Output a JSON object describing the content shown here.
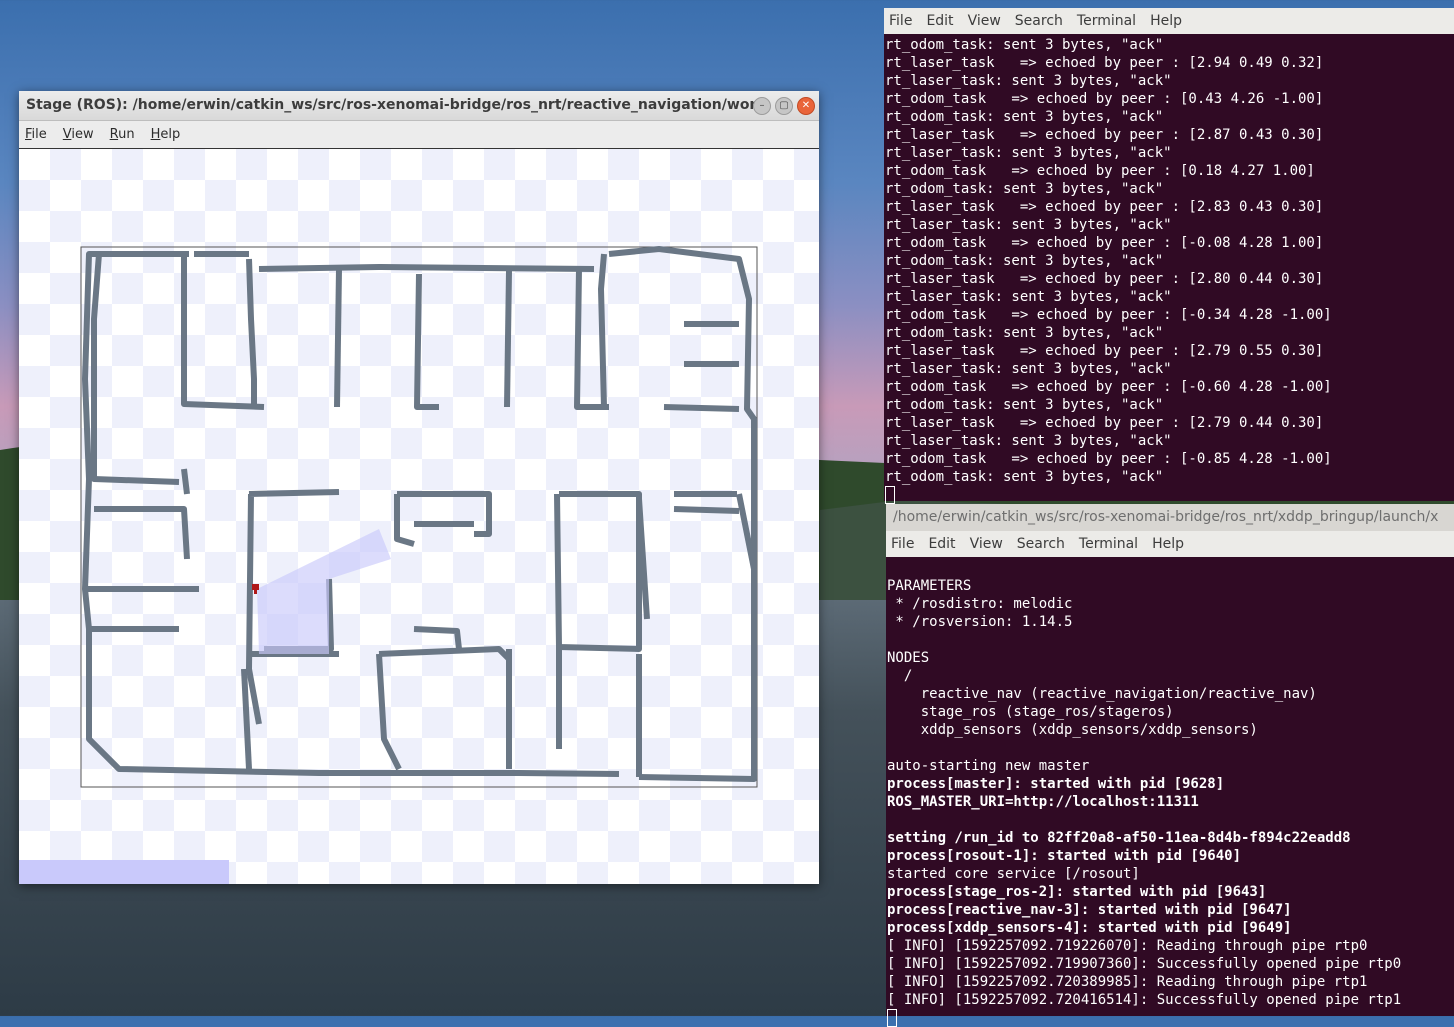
{
  "stage_window": {
    "title": "Stage (ROS): /home/erwin/catkin_ws/src/ros-xenomai-bridge/ros_nrt/reactive_navigation/worlds/ro...",
    "menu": [
      "File",
      "View",
      "Run",
      "Help"
    ],
    "buttons": {
      "minimize": "–",
      "maximize": "▢",
      "close": "✕"
    }
  },
  "terminal1": {
    "menu": [
      "File",
      "Edit",
      "View",
      "Search",
      "Terminal",
      "Help"
    ],
    "lines": [
      "rt_odom_task: sent 3 bytes, \"ack\"",
      "rt_laser_task   => echoed by peer : [2.94 0.49 0.32]",
      "rt_laser_task: sent 3 bytes, \"ack\"",
      "rt_odom_task   => echoed by peer : [0.43 4.26 -1.00]",
      "rt_odom_task: sent 3 bytes, \"ack\"",
      "rt_laser_task   => echoed by peer : [2.87 0.43 0.30]",
      "rt_laser_task: sent 3 bytes, \"ack\"",
      "rt_odom_task   => echoed by peer : [0.18 4.27 1.00]",
      "rt_odom_task: sent 3 bytes, \"ack\"",
      "rt_laser_task   => echoed by peer : [2.83 0.43 0.30]",
      "rt_laser_task: sent 3 bytes, \"ack\"",
      "rt_odom_task   => echoed by peer : [-0.08 4.28 1.00]",
      "rt_odom_task: sent 3 bytes, \"ack\"",
      "rt_laser_task   => echoed by peer : [2.80 0.44 0.30]",
      "rt_laser_task: sent 3 bytes, \"ack\"",
      "rt_odom_task   => echoed by peer : [-0.34 4.28 -1.00]",
      "rt_odom_task: sent 3 bytes, \"ack\"",
      "rt_laser_task   => echoed by peer : [2.79 0.55 0.30]",
      "rt_laser_task: sent 3 bytes, \"ack\"",
      "rt_odom_task   => echoed by peer : [-0.60 4.28 -1.00]",
      "rt_odom_task: sent 3 bytes, \"ack\"",
      "rt_laser_task   => echoed by peer : [2.79 0.44 0.30]",
      "rt_laser_task: sent 3 bytes, \"ack\"",
      "rt_odom_task   => echoed by peer : [-0.85 4.28 -1.00]",
      "rt_odom_task: sent 3 bytes, \"ack\""
    ]
  },
  "terminal2": {
    "title": "/home/erwin/catkin_ws/src/ros-xenomai-bridge/ros_nrt/xddp_bringup/launch/x",
    "menu": [
      "File",
      "Edit",
      "View",
      "Search",
      "Terminal",
      "Help"
    ],
    "lines": [
      {
        "text": "",
        "bold": false
      },
      {
        "text": "PARAMETERS",
        "bold": false
      },
      {
        "text": " * /rosdistro: melodic",
        "bold": false
      },
      {
        "text": " * /rosversion: 1.14.5",
        "bold": false
      },
      {
        "text": "",
        "bold": false
      },
      {
        "text": "NODES",
        "bold": false
      },
      {
        "text": "  /",
        "bold": false
      },
      {
        "text": "    reactive_nav (reactive_navigation/reactive_nav)",
        "bold": false
      },
      {
        "text": "    stage_ros (stage_ros/stageros)",
        "bold": false
      },
      {
        "text": "    xddp_sensors (xddp_sensors/xddp_sensors)",
        "bold": false
      },
      {
        "text": "",
        "bold": false
      },
      {
        "text": "auto-starting new master",
        "bold": false
      },
      {
        "text": "process[master]: started with pid [9628]",
        "bold": true
      },
      {
        "text": "ROS_MASTER_URI=http://localhost:11311",
        "bold": true
      },
      {
        "text": "",
        "bold": false
      },
      {
        "text": "setting /run_id to 82ff20a8-af50-11ea-8d4b-f894c22eadd8",
        "bold": true
      },
      {
        "text": "process[rosout-1]: started with pid [9640]",
        "bold": true
      },
      {
        "text": "started core service [/rosout]",
        "bold": false
      },
      {
        "text": "process[stage_ros-2]: started with pid [9643]",
        "bold": true
      },
      {
        "text": "process[reactive_nav-3]: started with pid [9647]",
        "bold": true
      },
      {
        "text": "process[xddp_sensors-4]: started with pid [9649]",
        "bold": true
      },
      {
        "text": "[ INFO] [1592257092.719226070]: Reading through pipe rtp0",
        "bold": false
      },
      {
        "text": "[ INFO] [1592257092.719907360]: Successfully opened pipe rtp0",
        "bold": false
      },
      {
        "text": "[ INFO] [1592257092.720389985]: Reading through pipe rtp1",
        "bold": false
      },
      {
        "text": "[ INFO] [1592257092.720416514]: Successfully opened pipe rtp1",
        "bold": false
      }
    ]
  },
  "colors": {
    "terminal_bg": "#300a24",
    "map_wall": "#6a7785",
    "laser": "#c9c9fb",
    "robot": "#b01818"
  }
}
